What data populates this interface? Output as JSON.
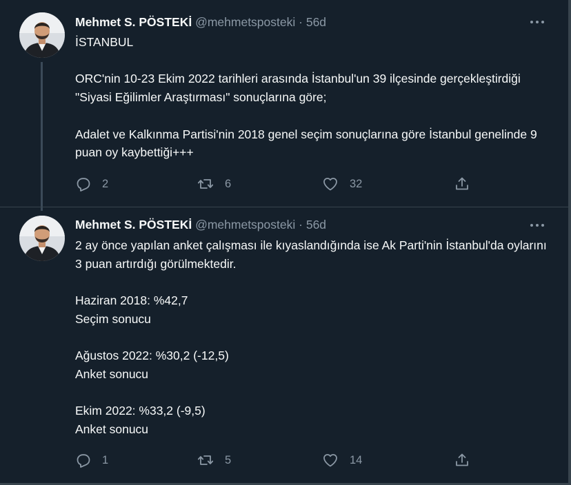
{
  "tweets": [
    {
      "author_name": "Mehmet S. PÖSTEKİ",
      "handle": "@mehmetsposteki",
      "separator": "·",
      "time": "56d",
      "text": "İSTANBUL\n\nORC'nin 10-23 Ekim 2022 tarihleri arasında İstanbul'un 39 ilçesinde gerçekleştirdiği \"Siyasi Eğilimler Araştırması\" sonuçlarına göre;\n\nAdalet ve Kalkınma Partisi'nin 2018 genel seçim sonuçlarına göre İstanbul genelinde 9 puan oy kaybettiği+++",
      "replies": "2",
      "retweets": "6",
      "likes": "32"
    },
    {
      "author_name": "Mehmet S. PÖSTEKİ",
      "handle": "@mehmetsposteki",
      "separator": "·",
      "time": "56d",
      "text": "2 ay önce yapılan anket çalışması ile kıyaslandığında ise Ak Parti'nin İstanbul'da oylarını 3 puan artırdığı görülmektedir.\n\nHaziran 2018: %42,7\nSeçim sonucu\n\nAğustos 2022: %30,2 (-12,5)\nAnket sonucu\n\nEkim 2022: %33,2 (-9,5)\nAnket sonucu",
      "replies": "1",
      "retweets": "5",
      "likes": "14"
    }
  ],
  "icons": {
    "reply": "reply-icon",
    "retweet": "retweet-icon",
    "like": "heart-icon",
    "share": "share-icon",
    "more": "more-icon"
  },
  "colors": {
    "background": "#15202b",
    "text": "#f7f9f9",
    "secondary": "#8b98a5",
    "divider": "#38444d"
  }
}
